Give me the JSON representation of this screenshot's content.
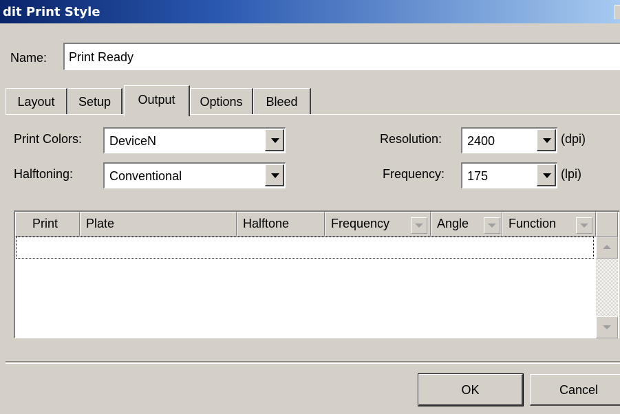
{
  "window": {
    "title": "dit Print Style"
  },
  "name_field": {
    "label": "Name:",
    "value": "Print Ready"
  },
  "tabs": [
    {
      "label": "Layout"
    },
    {
      "label": "Setup"
    },
    {
      "label": "Output",
      "active": true
    },
    {
      "label": "Options"
    },
    {
      "label": "Bleed"
    }
  ],
  "output": {
    "print_colors": {
      "label": "Print Colors:",
      "value": "DeviceN"
    },
    "halftoning": {
      "label": "Halftoning:",
      "value": "Conventional"
    },
    "resolution": {
      "label": "Resolution:",
      "value": "2400",
      "unit": "(dpi)"
    },
    "frequency": {
      "label": "Frequency:",
      "value": "175",
      "unit": "(lpi)"
    }
  },
  "plates_table": {
    "columns": [
      {
        "label": "Print"
      },
      {
        "label": "Plate"
      },
      {
        "label": "Halftone"
      },
      {
        "label": "Frequency"
      },
      {
        "label": "Angle"
      },
      {
        "label": "Function"
      }
    ],
    "rows": []
  },
  "buttons": {
    "ok": "OK",
    "cancel": "Cancel"
  },
  "colors": {
    "titlebar_start": "#0a246a",
    "titlebar_end": "#a6caf0",
    "dialog_bg": "#d4d0c8"
  }
}
